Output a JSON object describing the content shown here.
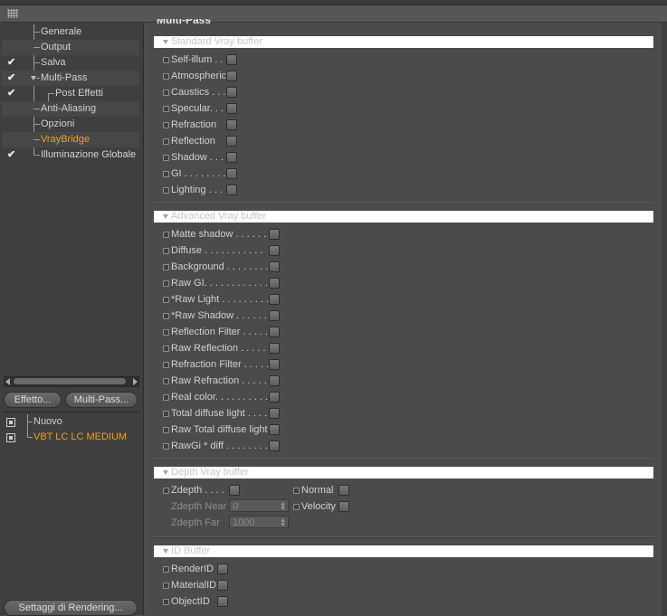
{
  "tree": {
    "items": [
      {
        "label": "Generale",
        "checked": false,
        "active": false
      },
      {
        "label": "Output",
        "checked": false,
        "active": false
      },
      {
        "label": "Salva",
        "checked": true,
        "active": false
      },
      {
        "label": "Multi-Pass",
        "checked": true,
        "active": false
      },
      {
        "label": "Post Effetti",
        "checked": true,
        "active": false
      },
      {
        "label": "Anti-Aliasing",
        "checked": false,
        "active": false
      },
      {
        "label": "Opzioni",
        "checked": false,
        "active": false
      },
      {
        "label": "VrayBridge",
        "checked": false,
        "active": true
      },
      {
        "label": "Illuminazione Globale",
        "checked": true,
        "active": false
      }
    ],
    "check_glyph": "✔"
  },
  "buttons": {
    "effetto": "Effetto...",
    "multipass": "Multi-Pass...",
    "render_settings": "Settaggi di Rendering..."
  },
  "scenes": {
    "items": [
      {
        "label": "Nuovo",
        "active": false
      },
      {
        "label": "VBT LC LC MEDIUM",
        "active": true
      }
    ]
  },
  "panel": {
    "cut_title": "Multi-Pass"
  },
  "standard": {
    "title": "Standard Vray buffer",
    "items": [
      "Self-illum . . .",
      "Atmospheric",
      "Caustics . . .",
      "Specular. . .",
      "Refraction",
      "Reflection",
      "Shadow . . .",
      "GI . . . . . . . .",
      "Lighting . . ."
    ]
  },
  "advanced": {
    "title": "Advanced Vray buffer",
    "items": [
      "Matte shadow . . . . . .",
      "Diffuse . . . . . . . . . . .",
      "Background . . . . . . . .",
      "Raw GI. . . . . . . . . . . .",
      "*Raw Light . . . . . . . . .",
      "*Raw Shadow . . . . . .",
      "Reflection Filter . . . . .",
      "Raw Reflection . . . . .",
      "Refraction Filter . . . . .",
      "Raw Refraction . . . . .",
      "Real color. . . . . . . . . .",
      "Total diffuse light . . . .",
      "Raw Total diffuse light",
      "RawGi * diff . . . . . . . ."
    ]
  },
  "depth": {
    "title": "Depth Vray buffer",
    "zdepth": "Zdepth . . . .",
    "normal": "Normal",
    "velocity": "Velocity",
    "near_label": "Zdepth Near",
    "near_value": "0",
    "far_label": "Zdepth Far",
    "far_value": "1000"
  },
  "id": {
    "title": "ID Buffer",
    "items": [
      "RenderID",
      "MaterialID",
      "ObjectID"
    ]
  }
}
